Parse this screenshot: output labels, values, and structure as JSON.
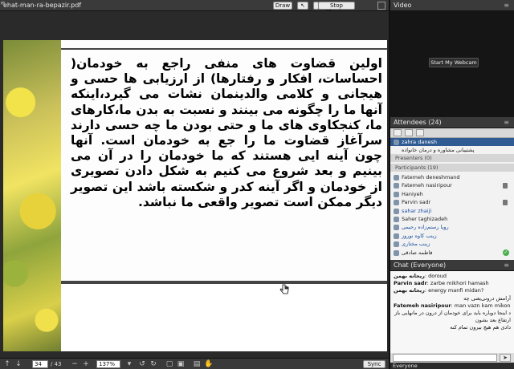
{
  "share": {
    "title": "ehat-man-ra-bepazir.pdf",
    "draw_label": "Draw",
    "stop_sharing_label": "Stop Sharing",
    "page_text": "اولین قضاوت های منفی راجع به خودمان( احساسات، افکار و رفتارها) از ارزیابی ها حسی و هیجانی و کلامی والدینمان نشات می گیرد،اینکه آنها ما را چگونه می بینند و نسبت به بدن ما،کارهای ما، کنجکاوی های ما و حتی بودن ما چه  حسی دارند سرآغاز قضاوت ما را جع به خودمان است. آنها چون آینه ایی هستند که ما خودمان را در آن می بینیم و بعد شروع می کنیم به شکل دادن تصویری  از خودمان و اگر آینه کدر و شکسته باشد این تصویر   دیگر ممکن است تصویر واقعی ما نباشد.",
    "current_page": "34",
    "page_total": "/ 43",
    "zoom": "137%",
    "sync_label": "Sync"
  },
  "video": {
    "title": "Video",
    "webcam_label": "Start My Webcam"
  },
  "attendees": {
    "title": "Attendees",
    "count": "(24)",
    "host": "zahra danesh",
    "host_sub": "پشتیبانی مشاوره و درمان خانواده",
    "presenters_label": "Presenters (0)",
    "participants_label": "Participants (19)",
    "participants": [
      {
        "name": "Fatemeh deneshmand",
        "style": "normal",
        "mic": false
      },
      {
        "name": "Fatemeh nasiripour",
        "style": "normal",
        "mic": true
      },
      {
        "name": "Haniyeh",
        "style": "normal",
        "mic": false
      },
      {
        "name": "Parvin sadr",
        "style": "normal",
        "mic": true
      },
      {
        "name": "sahar zhaiji",
        "style": "blue",
        "mic": false
      },
      {
        "name": "Saher taghizadeh",
        "style": "normal",
        "mic": false
      },
      {
        "name": "رویا رستم‌زاده رحیمی",
        "style": "blue",
        "mic": false
      },
      {
        "name": "زینب کاوه نوروز",
        "style": "blue",
        "mic": false
      },
      {
        "name": "زینب مختاری",
        "style": "blue",
        "mic": false
      },
      {
        "name": "فاطمه صادقی",
        "style": "selected",
        "mic": true
      }
    ]
  },
  "chat": {
    "title": "Chat",
    "scope": "(Everyone)",
    "messages": [
      {
        "sender": "ریحانه بهمن",
        "text": ": doroud",
        "rtl": false
      },
      {
        "sender": "Parvin sadr",
        "text": ": zarbe  mikhori hamash",
        "rtl": false
      },
      {
        "sender": "ریحانه بهمن",
        "text": ": energy manfi midan?",
        "rtl": false
      },
      {
        "sender": "",
        "text": "آرامش درونی‌یعنی چه",
        "rtl": true
      },
      {
        "sender": "Fatemeh nasiripour",
        "text": ": man vazn kam mikonam",
        "rtl": false
      },
      {
        "sender": "",
        "text": "د اینجا دوباره باید برای خودمان از درون در مانهایی باز کنیم که این عادت‌ها",
        "rtl": true
      },
      {
        "sender": "",
        "text": "ارتفاع بعد بشون",
        "rtl": true
      },
      {
        "sender": "",
        "text": "دادی هم هیچ بیرون تمام کنه",
        "rtl": true
      }
    ],
    "tab_label": "Everyone"
  }
}
